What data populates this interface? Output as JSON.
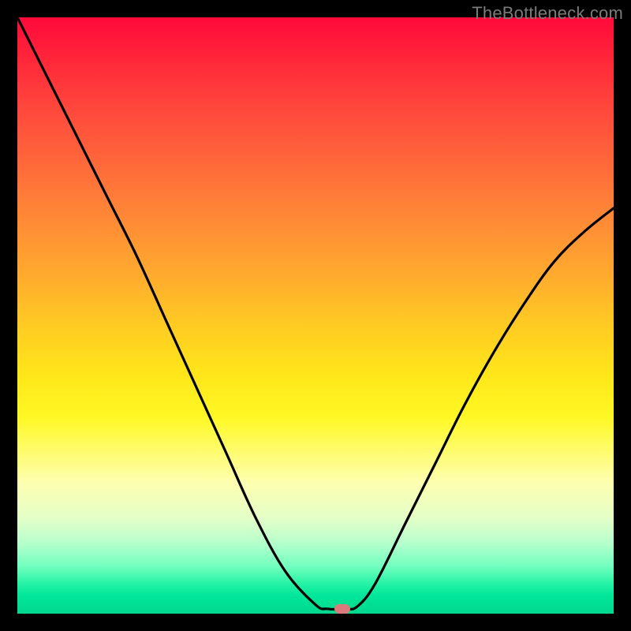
{
  "watermark": "TheBottleneck.com",
  "cursor": {
    "x_pct": 54.5,
    "y_pct": 99.2
  },
  "chart_data": {
    "type": "line",
    "title": "",
    "xlabel": "",
    "ylabel": "",
    "xlim": [
      0,
      100
    ],
    "ylim": [
      0,
      100
    ],
    "grid": false,
    "legend": false,
    "series": [
      {
        "name": "bottleneck-curve",
        "x": [
          0,
          5,
          10,
          15,
          20,
          25,
          30,
          35,
          40,
          45,
          50,
          52,
          55,
          57,
          60,
          65,
          70,
          75,
          80,
          85,
          90,
          95,
          100
        ],
        "values": [
          100,
          90,
          80,
          70,
          60,
          49,
          38,
          27,
          16,
          7,
          1.5,
          0.8,
          0.8,
          1.2,
          5,
          15,
          25,
          35,
          44,
          52,
          59,
          64,
          68
        ]
      }
    ],
    "annotations": [
      {
        "type": "marker",
        "x": 54.5,
        "y": 0.8,
        "label": "selected-point"
      }
    ],
    "background_gradient": {
      "direction": "vertical",
      "stops": [
        {
          "pos": 0.0,
          "color": "#ff0a3a"
        },
        {
          "pos": 0.25,
          "color": "#ff6a3a"
        },
        {
          "pos": 0.52,
          "color": "#ffcc22"
        },
        {
          "pos": 0.78,
          "color": "#fdffb0"
        },
        {
          "pos": 0.92,
          "color": "#73ffbf"
        },
        {
          "pos": 1.0,
          "color": "#00d88e"
        }
      ]
    }
  }
}
